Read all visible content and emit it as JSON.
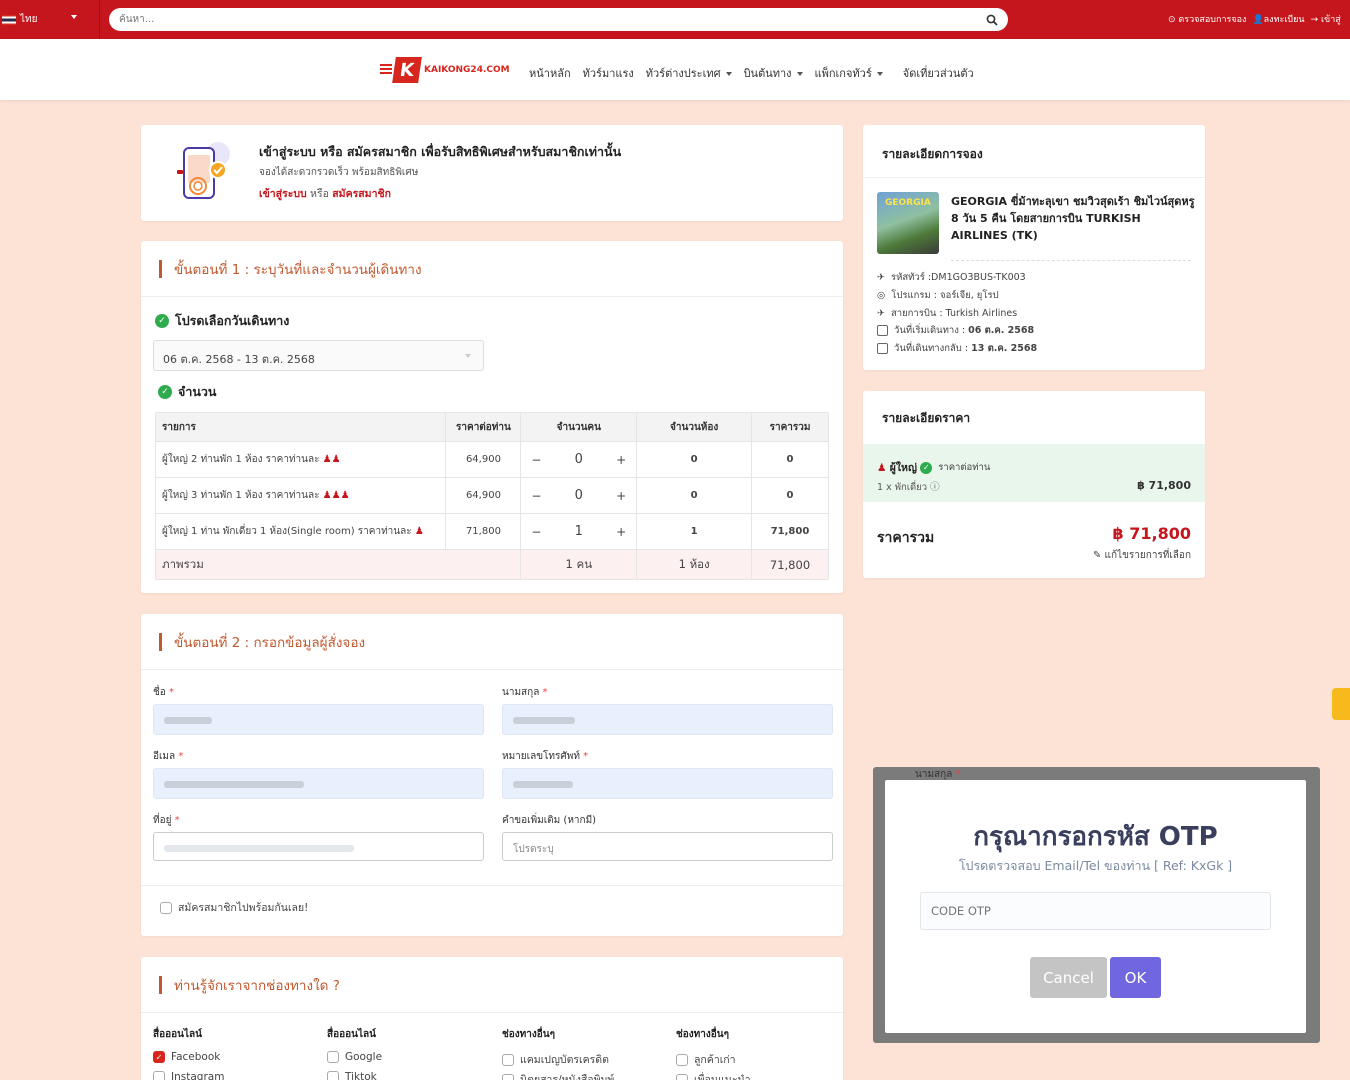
{
  "topbar": {
    "language": "ไทย",
    "search_placeholder": "ค้นหา...",
    "links": [
      "ตรวจสอบการจอง",
      "ลงทะเบียน",
      "เข้าสู่"
    ]
  },
  "nav": {
    "logo_text": "KAIKONG24.COM",
    "logo_letter": "K",
    "items": [
      "หน้าหลัก",
      "ทัวร์มาแรง",
      "ทัวร์ต่างประเทศ",
      "บินต้นทาง",
      "แพ็กเกจทัวร์",
      "จัดเที่ยวส่วนตัว"
    ]
  },
  "login_banner": {
    "title": "เข้าสู่ระบบ หรือ สมัครสมาชิก เพื่อรับสิทธิพิเศษสำหรับสมาชิกเท่านั้น",
    "subtitle": "จองได้สะดวกรวดเร็ว พร้อมสิทธิพิเศษ",
    "login_link": "เข้าสู่ระบบ",
    "or": "หรือ",
    "register_link": "สมัครสมาชิก"
  },
  "step1": {
    "title": "ขั้นตอนที่ 1 : ระบุวันที่และจำนวนผู้เดินทาง",
    "date_label": "โปรดเลือกวันเดินทาง",
    "date_value": "06 ต.ค. 2568 - 13 ต.ค. 2568",
    "qty_label": "จำนวน",
    "columns": [
      "รายการ",
      "ราคาต่อท่าน",
      "จำนวนคน",
      "จำนวนห้อง",
      "ราคารวม"
    ],
    "rows": [
      {
        "item": "ผู้ใหญ่ 2 ท่านพัก 1 ห้อง ราคาท่านละ",
        "icons": "👫",
        "price": "64,900",
        "persons": "0",
        "rooms": "0",
        "total": "0"
      },
      {
        "item": "ผู้ใหญ่ 3 ท่านพัก 1 ห้อง ราคาท่านละ",
        "icons": "👪",
        "price": "64,900",
        "persons": "0",
        "rooms": "0",
        "total": "0"
      },
      {
        "item": "ผู้ใหญ่ 1 ท่าน พักเดี่ยว 1 ห้อง(Single room) ราคาท่านละ",
        "icons": "👤",
        "price": "71,800",
        "persons": "1",
        "rooms": "1",
        "total": "71,800"
      }
    ],
    "summary": {
      "label": "ภาพรวม",
      "persons": "1 คน",
      "rooms": "1 ห้อง",
      "total": "71,800"
    }
  },
  "step2": {
    "title": "ขั้นตอนที่ 2 : กรอกข้อมูลผู้สั่งจอง",
    "first_name": "ชื่อ",
    "last_name": "นามสกุล",
    "email": "อีเมล",
    "phone": "หมายเลขโทรศัพท์",
    "address": "ที่อยู่",
    "note": "คำขอเพิ่มเติม (หากมี)",
    "note_placeholder": "โปรดระบุ",
    "register_check": "สมัครสมาชิกไปพร้อมกันเลย!"
  },
  "step3": {
    "title": "ท่านรู้จักเราจากช่องทางใด ?",
    "cols": [
      {
        "head": "สื่อออนไลน์",
        "items": [
          "Facebook",
          "Instagram"
        ]
      },
      {
        "head": "สื่อออนไลน์",
        "items": [
          "Google",
          "Tiktok"
        ]
      },
      {
        "head": "ช่องทางอื่นๆ",
        "items": [
          "แคมเปญบัตรเครดิต",
          "นิตยสาร/หนังสือพิมพ์"
        ]
      },
      {
        "head": "ช่องทางอื่นๆ",
        "items": [
          "ลูกค้าเก่า",
          "เพื่อนแนะนำ"
        ]
      }
    ]
  },
  "booking": {
    "title": "รายละเอียดการจอง",
    "thumb_text": "GEORGIA",
    "tour_name": "GEORGIA ขี่ม้าทะลุเขา ชมวิวสุดเร้า ชิมไวน์สุดหรู 8 วัน 5 คืน โดยสายการบิน TURKISH AIRLINES (TK)",
    "tour_code": "รหัสทัวร์ :DM1GO3BUS-TK003",
    "program": "โปรแกรม : จอร์เจีย, ยุโรป",
    "airline": "สายการบิน : Turkish Airlines",
    "depart_label": "วันที่เริ่มเดินทาง :",
    "depart": "06 ต.ค. 2568",
    "return_label": "วันที่เดินทางกลับ :",
    "return": "13 ต.ค. 2568"
  },
  "price_detail": {
    "title": "รายละเอียดราคา",
    "adult": "ผู้ใหญ่",
    "per_person": "ราคาต่อท่าน",
    "single": "1 x พักเดี่ยว",
    "amount": "฿ 71,800",
    "total_label": "ราคารวม",
    "total": "฿ 71,800",
    "edit": "แก้ไขรายการที่เลือก"
  },
  "modal": {
    "ghost_label": "นามสกุล",
    "title": "กรุณากรอกรหัส OTP",
    "hint": "โปรดตรวจสอบ Email/Tel ของท่าน [ Ref: KxGk ]",
    "placeholder": "CODE OTP",
    "cancel": "Cancel",
    "ok": "OK"
  },
  "colors": {
    "brand_red": "#c4161c",
    "accent_orange": "#c0592f",
    "ok_button": "#7066e0",
    "success_green": "#2eab4c",
    "page_bg": "#fde3d5"
  }
}
